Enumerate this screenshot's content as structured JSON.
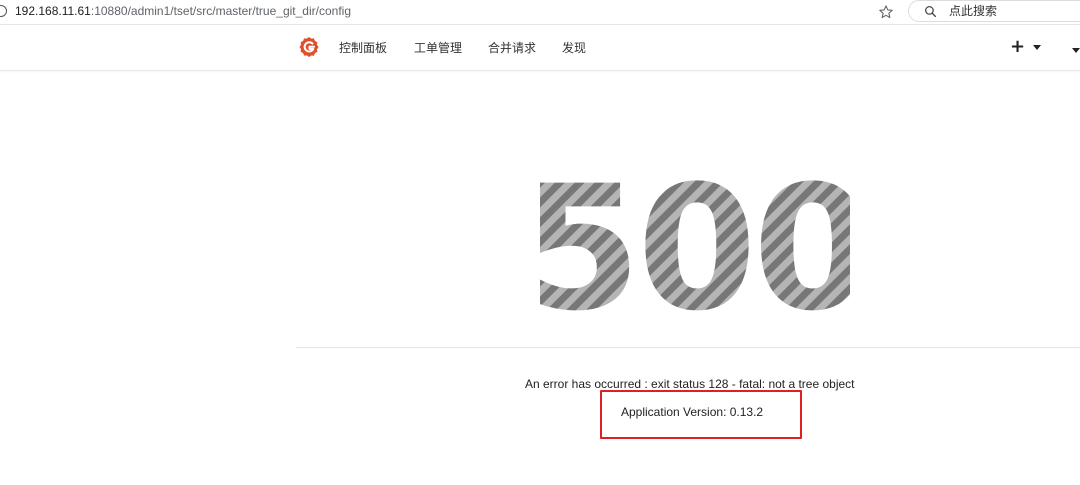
{
  "browser": {
    "url_host": "192.168.11.61",
    "url_path": ":10880/admin1/tset/src/master/true_git_dir/config",
    "search_placeholder": "点此搜索",
    "icons": [
      "page-info-icon",
      "star-icon",
      "search-icon"
    ]
  },
  "navbar": {
    "logo": "gitea-logo-icon",
    "items": [
      {
        "label": "控制面板"
      },
      {
        "label": "工单管理"
      },
      {
        "label": "合并请求"
      },
      {
        "label": "发现"
      }
    ],
    "create_label": "+",
    "icons": [
      "plus-icon",
      "caret-down-icon",
      "caret-down-icon"
    ]
  },
  "error": {
    "code": "500",
    "message": "An error has occurred : exit status 128 - fatal: not a tree object",
    "version": "Application Version: 0.13.2"
  },
  "colors": {
    "logo": "#e0502d",
    "code_stripe_dark": "#7a7a7a",
    "code_stripe_light": "#b0b0b0",
    "highlight_box": "#e02020"
  }
}
